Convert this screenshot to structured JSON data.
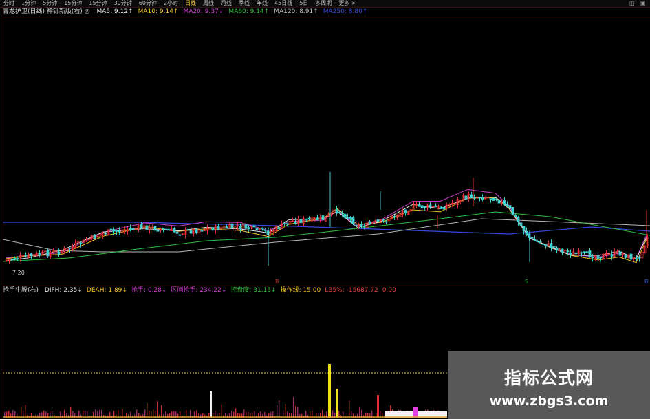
{
  "toolbar": {
    "tabs": [
      "分时",
      "1分钟",
      "5分钟",
      "15分钟",
      "15分钟",
      "30分钟",
      "60分钟",
      "2小时",
      "日线",
      "周线",
      "月线",
      "季线",
      "年线",
      "45日线",
      "5日",
      "多周期",
      "更多 >"
    ],
    "active_index": 8,
    "window_controls": [
      "◫",
      "▣"
    ]
  },
  "indicator_main": {
    "title": "青龙护卫(日线) 神针新版(右) ◎",
    "mas": [
      {
        "label": "MA5: 9.12↑",
        "color": "#e8e8e8"
      },
      {
        "label": "MA10: 9.14↑",
        "color": "#f0c020"
      },
      {
        "label": "MA20: 9.37↓",
        "color": "#d040d0"
      },
      {
        "label": "MA60: 9.14↑",
        "color": "#30c040"
      },
      {
        "label": "MA120: 8.91↑",
        "color": "#b8b8b8"
      },
      {
        "label": "MA250: 8.80↑",
        "color": "#3848e0"
      }
    ]
  },
  "indicator_sub": {
    "title": "抢手牛股(右)",
    "items": [
      {
        "label": "DIFH: 2.35↓",
        "color": "#e8e8e8"
      },
      {
        "label": "DEAH: 1.89↓",
        "color": "#f0c020"
      },
      {
        "label": "抢手: 0.28↓",
        "color": "#d040d0"
      },
      {
        "label": "区间抢手: 234.22↓",
        "color": "#d040d0"
      },
      {
        "label": "控盘度: 31.15↓",
        "color": "#30c040"
      },
      {
        "label": "操作线: 15.00",
        "color": "#f0c020"
      },
      {
        "label": "LB5%: -15687.72",
        "color": "#e04040"
      },
      {
        "label": "0.00",
        "color": "#e04040"
      }
    ]
  },
  "price_label": "7.20",
  "markers": [
    {
      "label": "B",
      "color": "#e03030"
    },
    {
      "label": "S",
      "color": "#30c040"
    },
    {
      "label": "B",
      "color": "#3060e0"
    }
  ],
  "watermark": {
    "title": "指标公式网",
    "url": "www.zbgs3.com"
  },
  "colors": {
    "up": "#e03030",
    "down": "#40d0d0",
    "ma5": "#e8e8e8",
    "ma10": "#f0c020",
    "ma20": "#d040d0",
    "ma60": "#30c040",
    "ma120": "#b8b8b8",
    "ma250": "#3848e0"
  }
}
